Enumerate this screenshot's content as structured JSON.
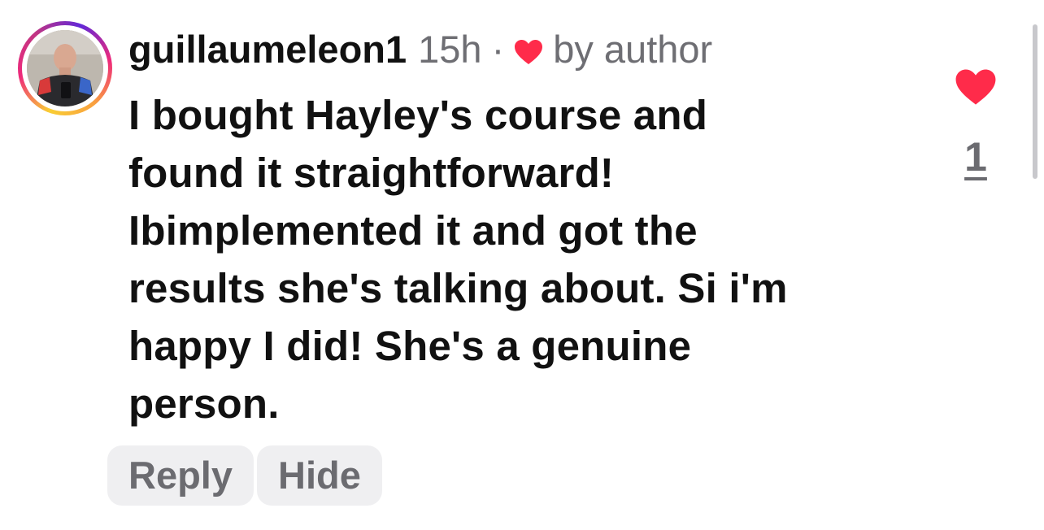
{
  "comment": {
    "username": "guillaumeleon1",
    "time": "15h",
    "separator": "·",
    "liked_by_author": "by author",
    "text": "I bought Hayley's course and found it straightforward! Ibimplemented it and got the results she's talking about. Si i'm happy I did! She's a genuine person.",
    "text_lines": [
      "I bought Hayley's course and",
      "found it straightforward!",
      "Ibimplemented it and got the",
      "results she's talking about. Si i'm",
      "happy I did! She's a genuine",
      "person."
    ],
    "like_count": "1"
  },
  "actions": {
    "reply_label": "Reply",
    "hide_label": "Hide"
  },
  "icons": {
    "avatar": "avatar",
    "author_heart": "heart-icon",
    "like_button": "heart-icon"
  },
  "colors": {
    "heart_red": "#ff2b4a",
    "meta_gray": "#6e6e73",
    "button_bg": "#efeff1",
    "ring_start": "#f9ce34",
    "ring_mid": "#ee2a7b",
    "ring_end": "#6228d7"
  }
}
